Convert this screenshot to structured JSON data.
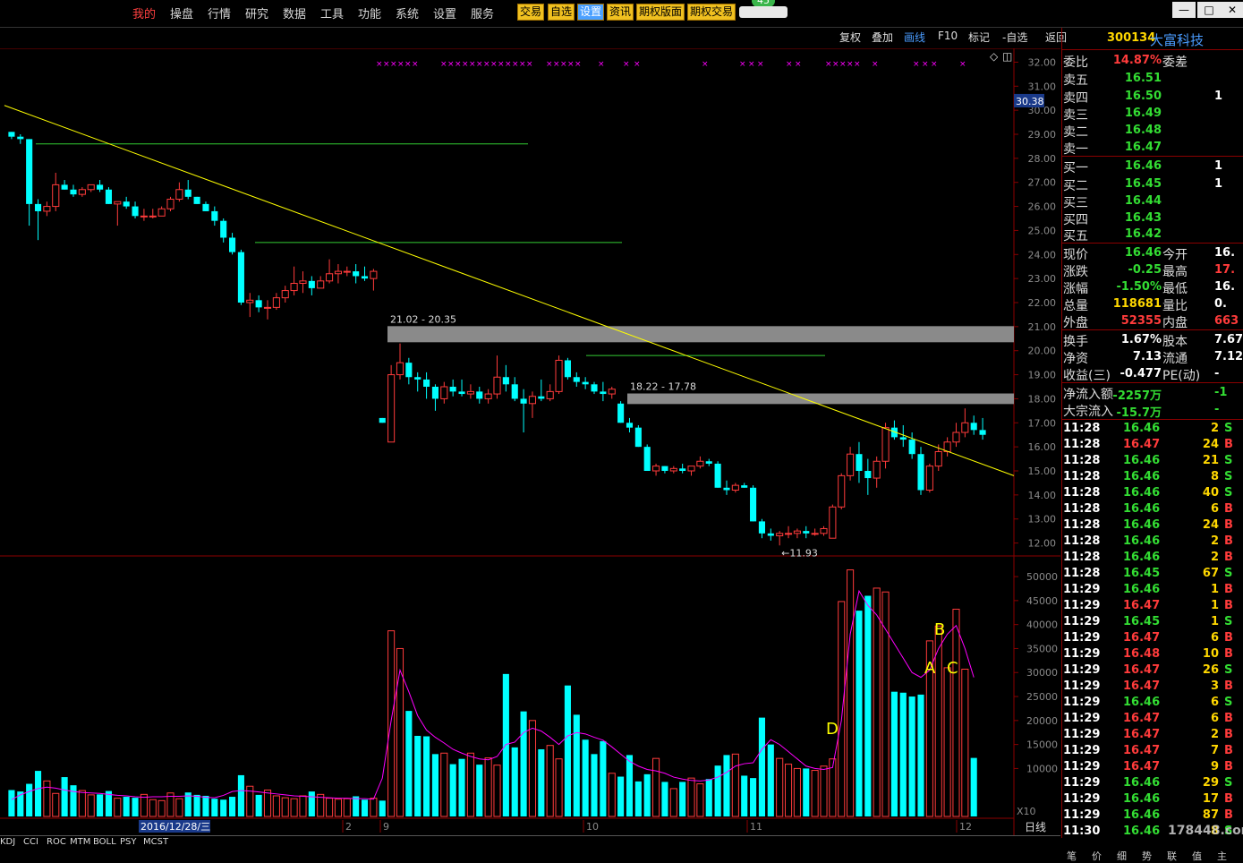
{
  "menu": {
    "items": [
      "我的",
      "操盘",
      "行情",
      "研究",
      "数据",
      "工具",
      "功能",
      "系统",
      "设置",
      "服务"
    ],
    "active_index": 0,
    "buttons": [
      "交易",
      "自选",
      "设置",
      "资讯",
      "期权版面",
      "期权交易"
    ],
    "badge": "45"
  },
  "window_controls": [
    "—",
    "□",
    "✕"
  ],
  "toolbar": {
    "items": [
      "复权",
      "叠加",
      "画线",
      "F10",
      "标记",
      "-自选",
      "返回"
    ],
    "selected_index": 2
  },
  "stock": {
    "code": "300134",
    "name": "大富科技"
  },
  "price_axis": [
    "32.00",
    "31.00",
    "30.00",
    "29.00",
    "28.00",
    "27.00",
    "26.00",
    "25.00",
    "24.00",
    "23.00",
    "22.00",
    "21.00",
    "20.00",
    "19.00",
    "18.00",
    "17.00",
    "16.00",
    "15.00",
    "14.00",
    "13.00",
    "12.00"
  ],
  "current_price_marker": "30.38",
  "volume_axis": [
    "50000",
    "45000",
    "40000",
    "35000",
    "30000",
    "25000",
    "20000",
    "15000",
    "10000"
  ],
  "volume_unit": "X10",
  "annotations": {
    "zone1": "21.02 - 20.35",
    "zone2": "18.22 - 17.78",
    "low": "11.93",
    "labels": [
      "A",
      "B",
      "C",
      "D"
    ]
  },
  "time_axis": {
    "date_label": "2016/12/28/三",
    "months": [
      "2",
      "9",
      "10",
      "11",
      "12"
    ],
    "period": "日线",
    "zoom": [
      "+",
      "-"
    ]
  },
  "indicator_tabs": [
    "KDJ",
    "CCI",
    "ROC",
    "MTM",
    "BOLL",
    "PSY",
    "MCST"
  ],
  "quote": {
    "top": [
      {
        "label": "委比",
        "value": "14.87%",
        "value_color": "#ff3b3b",
        "label2": "委差",
        "value2": ""
      },
      {
        "label": "卖五",
        "value": "16.51",
        "value_color": "#33dd33",
        "label2": "",
        "value2": ""
      },
      {
        "label": "卖四",
        "value": "16.50",
        "value_color": "#33dd33",
        "label2": "",
        "value2": "1"
      },
      {
        "label": "卖三",
        "value": "16.49",
        "value_color": "#33dd33",
        "label2": "",
        "value2": ""
      },
      {
        "label": "卖二",
        "value": "16.48",
        "value_color": "#33dd33",
        "label2": "",
        "value2": ""
      },
      {
        "label": "卖一",
        "value": "16.47",
        "value_color": "#33dd33",
        "label2": "",
        "value2": ""
      },
      {
        "label": "买一",
        "value": "16.46",
        "value_color": "#33dd33",
        "label2": "",
        "value2": "1"
      },
      {
        "label": "买二",
        "value": "16.45",
        "value_color": "#33dd33",
        "label2": "",
        "value2": "1"
      },
      {
        "label": "买三",
        "value": "16.44",
        "value_color": "#33dd33",
        "label2": "",
        "value2": ""
      },
      {
        "label": "买四",
        "value": "16.43",
        "value_color": "#33dd33",
        "label2": "",
        "value2": ""
      },
      {
        "label": "买五",
        "value": "16.42",
        "value_color": "#33dd33",
        "label2": "",
        "value2": ""
      },
      {
        "label": "现价",
        "value": "16.46",
        "value_color": "#33dd33",
        "label2": "今开",
        "value2": "16."
      },
      {
        "label": "涨跌",
        "value": "-0.25",
        "value_color": "#33dd33",
        "label2": "最高",
        "value2": "17."
      },
      {
        "label": "涨幅",
        "value": "-1.50%",
        "value_color": "#33dd33",
        "label2": "最低",
        "value2": "16."
      },
      {
        "label": "总量",
        "value": "118681",
        "value_color": "#ffd700",
        "label2": "量比",
        "value2": "0."
      },
      {
        "label": "外盘",
        "value": "52355",
        "value_color": "#ff3b3b",
        "label2": "内盘",
        "value2": "663"
      },
      {
        "label": "换手",
        "value": "1.67%",
        "value_color": "#ffffff",
        "label2": "股本",
        "value2": "7.67"
      },
      {
        "label": "净资",
        "value": "7.13",
        "value_color": "#ffffff",
        "label2": "流通",
        "value2": "7.12"
      },
      {
        "label": "收益(三)",
        "value": "-0.477",
        "value_color": "#ffffff",
        "label2": "PE(动)",
        "value2": "-"
      },
      {
        "label": "净流入额",
        "value": "-2257万",
        "value_color": "#33dd33",
        "label2": "",
        "value2": "-1"
      },
      {
        "label": "大宗流入",
        "value": "-15.7万",
        "value_color": "#33dd33",
        "label2": "",
        "value2": "-"
      }
    ],
    "ticks": [
      {
        "t": "11:28",
        "p": "16.46",
        "v": "2",
        "bs": "S"
      },
      {
        "t": "11:28",
        "p": "16.47",
        "v": "24",
        "bs": "B"
      },
      {
        "t": "11:28",
        "p": "16.46",
        "v": "21",
        "bs": "S"
      },
      {
        "t": "11:28",
        "p": "16.46",
        "v": "8",
        "bs": "S"
      },
      {
        "t": "11:28",
        "p": "16.46",
        "v": "40",
        "bs": "S"
      },
      {
        "t": "11:28",
        "p": "16.46",
        "v": "6",
        "bs": "B"
      },
      {
        "t": "11:28",
        "p": "16.46",
        "v": "24",
        "bs": "B"
      },
      {
        "t": "11:28",
        "p": "16.46",
        "v": "2",
        "bs": "B"
      },
      {
        "t": "11:28",
        "p": "16.46",
        "v": "2",
        "bs": "B"
      },
      {
        "t": "11:28",
        "p": "16.45",
        "v": "67",
        "bs": "S"
      },
      {
        "t": "11:29",
        "p": "16.46",
        "v": "1",
        "bs": "B"
      },
      {
        "t": "11:29",
        "p": "16.47",
        "v": "1",
        "bs": "B"
      },
      {
        "t": "11:29",
        "p": "16.45",
        "v": "1",
        "bs": "S"
      },
      {
        "t": "11:29",
        "p": "16.47",
        "v": "6",
        "bs": "B"
      },
      {
        "t": "11:29",
        "p": "16.48",
        "v": "10",
        "bs": "B"
      },
      {
        "t": "11:29",
        "p": "16.47",
        "v": "26",
        "bs": "S"
      },
      {
        "t": "11:29",
        "p": "16.47",
        "v": "3",
        "bs": "B"
      },
      {
        "t": "11:29",
        "p": "16.46",
        "v": "6",
        "bs": "S"
      },
      {
        "t": "11:29",
        "p": "16.47",
        "v": "6",
        "bs": "B"
      },
      {
        "t": "11:29",
        "p": "16.47",
        "v": "2",
        "bs": "B"
      },
      {
        "t": "11:29",
        "p": "16.47",
        "v": "7",
        "bs": "B"
      },
      {
        "t": "11:29",
        "p": "16.47",
        "v": "9",
        "bs": "B"
      },
      {
        "t": "11:29",
        "p": "16.46",
        "v": "29",
        "bs": "S"
      },
      {
        "t": "11:29",
        "p": "16.46",
        "v": "17",
        "bs": "B"
      },
      {
        "t": "11:29",
        "p": "16.46",
        "v": "87",
        "bs": "B"
      },
      {
        "t": "11:30",
        "p": "16.46",
        "v": "8",
        "bs": "S"
      }
    ],
    "watermark": "178448.com",
    "bottom_tabs": [
      "笔",
      "价",
      "细",
      "势",
      "联",
      "值",
      "主"
    ]
  },
  "colors": {
    "up": "#ff3b3b",
    "down": "#00ffff",
    "ma": "#ff00ff",
    "trend": "#ffff00",
    "resistance": "#33cc33",
    "zone": "#8a8a8a"
  },
  "chart_data": {
    "type": "candlestick",
    "title": "",
    "candles": [
      [
        29.1,
        29.1,
        28.8,
        28.9
      ],
      [
        28.9,
        29.0,
        28.6,
        28.8
      ],
      [
        28.8,
        28.8,
        25.2,
        26.1
      ],
      [
        26.1,
        26.3,
        24.6,
        25.8
      ],
      [
        25.8,
        26.2,
        25.6,
        26.0
      ],
      [
        26.0,
        27.4,
        25.8,
        26.9
      ],
      [
        26.9,
        27.1,
        26.7,
        26.7
      ],
      [
        26.7,
        26.9,
        26.4,
        26.5
      ],
      [
        26.5,
        26.8,
        26.4,
        26.7
      ],
      [
        26.7,
        26.9,
        26.6,
        26.9
      ],
      [
        26.9,
        27.1,
        26.6,
        26.7
      ],
      [
        26.7,
        26.8,
        26.1,
        26.1
      ],
      [
        26.1,
        26.2,
        25.2,
        26.2
      ],
      [
        26.2,
        26.4,
        25.9,
        26.0
      ],
      [
        26.0,
        26.2,
        25.5,
        25.6
      ],
      [
        25.6,
        25.9,
        25.4,
        25.6
      ],
      [
        25.6,
        25.9,
        25.5,
        25.6
      ],
      [
        25.6,
        26.0,
        25.6,
        25.9
      ],
      [
        25.9,
        26.4,
        25.8,
        26.3
      ],
      [
        26.3,
        27.0,
        26.2,
        26.7
      ],
      [
        26.7,
        27.1,
        26.3,
        26.4
      ],
      [
        26.4,
        26.4,
        26.1,
        26.1
      ],
      [
        26.1,
        26.2,
        25.8,
        25.8
      ],
      [
        25.8,
        26.0,
        25.2,
        25.4
      ],
      [
        25.4,
        25.5,
        24.5,
        24.7
      ],
      [
        24.7,
        24.9,
        24.0,
        24.1
      ],
      [
        24.1,
        24.2,
        21.9,
        22.0
      ],
      [
        22.0,
        22.4,
        21.4,
        22.1
      ],
      [
        22.1,
        22.3,
        21.6,
        21.8
      ],
      [
        21.8,
        22.1,
        21.3,
        21.8
      ],
      [
        21.8,
        22.4,
        21.7,
        22.2
      ],
      [
        22.2,
        22.7,
        22.0,
        22.5
      ],
      [
        22.5,
        23.5,
        22.3,
        22.8
      ],
      [
        22.8,
        23.3,
        22.4,
        22.9
      ],
      [
        22.9,
        23.1,
        22.3,
        22.6
      ],
      [
        22.6,
        23.1,
        22.6,
        22.9
      ],
      [
        22.9,
        23.8,
        22.8,
        23.2
      ],
      [
        23.2,
        23.6,
        22.8,
        23.3
      ],
      [
        23.3,
        23.5,
        23.1,
        23.3
      ],
      [
        23.3,
        23.6,
        22.8,
        23.1
      ],
      [
        23.1,
        23.5,
        22.9,
        23.0
      ],
      [
        23.0,
        23.4,
        22.5,
        23.3
      ],
      [
        17.2,
        17.2,
        17.0,
        17.0
      ],
      [
        16.2,
        19.4,
        16.2,
        19.0
      ],
      [
        19.0,
        20.3,
        18.8,
        19.5
      ],
      [
        19.5,
        19.7,
        18.6,
        18.9
      ],
      [
        18.9,
        19.1,
        18.3,
        18.8
      ],
      [
        18.8,
        19.1,
        18.0,
        18.5
      ],
      [
        18.5,
        18.6,
        17.5,
        18.0
      ],
      [
        18.0,
        18.7,
        17.8,
        18.5
      ],
      [
        18.5,
        18.8,
        18.1,
        18.3
      ],
      [
        18.3,
        18.8,
        18.1,
        18.2
      ],
      [
        18.2,
        18.6,
        18.0,
        18.3
      ],
      [
        18.3,
        18.5,
        17.8,
        18.0
      ],
      [
        18.0,
        18.4,
        17.8,
        18.2
      ],
      [
        18.2,
        19.8,
        18.0,
        18.9
      ],
      [
        18.9,
        19.4,
        18.3,
        18.6
      ],
      [
        18.6,
        18.9,
        17.9,
        18.0
      ],
      [
        18.0,
        18.4,
        16.6,
        17.8
      ],
      [
        17.8,
        18.3,
        17.2,
        18.1
      ],
      [
        18.1,
        18.8,
        17.9,
        18.0
      ],
      [
        18.0,
        18.6,
        17.9,
        18.3
      ],
      [
        18.3,
        19.8,
        18.2,
        19.6
      ],
      [
        19.6,
        19.7,
        18.8,
        18.9
      ],
      [
        18.9,
        19.1,
        18.5,
        18.7
      ],
      [
        18.7,
        18.9,
        18.4,
        18.6
      ],
      [
        18.6,
        18.7,
        18.2,
        18.3
      ],
      [
        18.3,
        18.7,
        17.9,
        18.2
      ],
      [
        18.2,
        18.5,
        18.0,
        18.4
      ],
      [
        17.8,
        17.9,
        17.0,
        17.0
      ],
      [
        17.0,
        17.2,
        16.6,
        16.8
      ],
      [
        16.8,
        16.9,
        16.0,
        16.0
      ],
      [
        16.0,
        16.1,
        15.0,
        15.0
      ],
      [
        15.0,
        15.3,
        14.8,
        15.2
      ],
      [
        15.2,
        15.2,
        14.9,
        15.0
      ],
      [
        15.0,
        15.2,
        14.9,
        15.1
      ],
      [
        15.1,
        15.3,
        14.9,
        15.0
      ],
      [
        15.0,
        15.2,
        14.8,
        15.2
      ],
      [
        15.2,
        15.6,
        15.1,
        15.4
      ],
      [
        15.4,
        15.5,
        15.2,
        15.3
      ],
      [
        15.3,
        15.4,
        14.3,
        14.3
      ],
      [
        14.3,
        14.6,
        14.0,
        14.2
      ],
      [
        14.2,
        14.5,
        14.1,
        14.4
      ],
      [
        14.4,
        14.5,
        14.3,
        14.3
      ],
      [
        14.3,
        14.4,
        12.9,
        12.9
      ],
      [
        12.9,
        13.0,
        12.2,
        12.4
      ],
      [
        12.4,
        12.6,
        12.1,
        12.3
      ],
      [
        12.3,
        12.5,
        11.9,
        12.4
      ],
      [
        12.4,
        12.7,
        12.2,
        12.4
      ],
      [
        12.4,
        12.6,
        12.2,
        12.5
      ],
      [
        12.5,
        12.7,
        12.2,
        12.4
      ],
      [
        12.4,
        12.6,
        12.3,
        12.4
      ],
      [
        12.4,
        12.7,
        12.3,
        12.6
      ],
      [
        12.2,
        13.6,
        12.2,
        13.5
      ],
      [
        13.5,
        14.9,
        13.4,
        14.8
      ],
      [
        14.8,
        16.0,
        14.6,
        15.7
      ],
      [
        15.7,
        16.2,
        14.5,
        15.0
      ],
      [
        15.0,
        15.5,
        14.0,
        14.7
      ],
      [
        14.7,
        15.6,
        14.3,
        15.4
      ],
      [
        15.4,
        17.0,
        15.1,
        16.8
      ],
      [
        16.8,
        17.1,
        16.3,
        16.4
      ],
      [
        16.4,
        16.9,
        16.0,
        16.3
      ],
      [
        16.3,
        16.6,
        15.5,
        15.7
      ],
      [
        15.7,
        16.0,
        14.0,
        14.2
      ],
      [
        14.2,
        15.3,
        14.1,
        15.2
      ],
      [
        15.2,
        16.1,
        15.0,
        15.8
      ],
      [
        15.8,
        16.4,
        15.6,
        16.2
      ],
      [
        16.2,
        17.0,
        16.0,
        16.6
      ],
      [
        16.6,
        17.6,
        16.4,
        17.0
      ],
      [
        17.0,
        17.3,
        16.5,
        16.7
      ],
      [
        16.7,
        17.2,
        16.3,
        16.5
      ]
    ],
    "volumes": [
      5500,
      5200,
      6800,
      9500,
      7400,
      4800,
      8200,
      6500,
      5400,
      4500,
      4600,
      5300,
      3800,
      4100,
      3900,
      4600,
      3500,
      3300,
      4900,
      3700,
      5000,
      4500,
      4300,
      3700,
      3500,
      4100,
      8600,
      6300,
      4500,
      5500,
      4300,
      3900,
      3700,
      4300,
      5200,
      4600,
      3800,
      3600,
      3700,
      4200,
      3500,
      3800,
      3300,
      38700,
      35000,
      22000,
      16800,
      16700,
      13000,
      13200,
      10900,
      12000,
      13200,
      10800,
      12200,
      10700,
      29700,
      14400,
      21900,
      20000,
      14000,
      14800,
      12000,
      27300,
      21200,
      16000,
      13000,
      15700,
      9000,
      8300,
      12800,
      7300,
      8800,
      12100,
      7200,
      5800,
      7200,
      8000,
      6800,
      7800,
      10600,
      12800,
      13000,
      8500,
      8000,
      20600,
      15000,
      12100,
      10900,
      10000,
      10000,
      9600,
      10500,
      12000,
      44800,
      51400,
      42900,
      46000,
      47600,
      46800,
      26000,
      25800,
      25000,
      25400,
      36600,
      39700,
      31000,
      43200,
      30700,
      12200
    ],
    "moving_avg": [
      3500,
      4500,
      5200,
      5800,
      6100,
      5900,
      5500,
      5200,
      5000,
      4900,
      4800,
      4600,
      4400,
      4300,
      4100,
      4000,
      4100,
      4100,
      4200,
      4200,
      4300,
      4200,
      4000,
      3900,
      4400,
      5200,
      5400,
      5300,
      5100,
      4900,
      4700,
      4500,
      4300,
      4200,
      4100,
      4000,
      3900,
      3800,
      3800,
      3700,
      3700,
      3600,
      8000,
      20000,
      30500,
      26000,
      21000,
      18000,
      16500,
      15300,
      14000,
      13200,
      12500,
      12000,
      11800,
      12500,
      15000,
      15500,
      17500,
      18400,
      17800,
      16500,
      15000,
      16800,
      17500,
      17200,
      16500,
      15900,
      14500,
      13000,
      11500,
      10500,
      9800,
      9500,
      9000,
      8200,
      7800,
      7500,
      7400,
      7600,
      8200,
      9200,
      10500,
      11000,
      11200,
      14000,
      16000,
      15000,
      13500,
      12000,
      10500,
      10000,
      9800,
      10200,
      20000,
      38000,
      47000,
      44000,
      42000,
      39000,
      36000,
      33000,
      30000,
      29000,
      30500,
      35000,
      38000,
      39800,
      35000,
      29000
    ],
    "price_range": [
      11.5,
      32.5
    ],
    "volume_range": [
      0,
      53000
    ],
    "support_resistance_levels": [
      28.6,
      24.5,
      19.8
    ],
    "zones": [
      [
        20.35,
        21.02
      ],
      [
        17.78,
        18.22
      ]
    ],
    "trendline": [
      [
        0,
        30.2
      ],
      [
        110,
        14.8
      ]
    ]
  }
}
